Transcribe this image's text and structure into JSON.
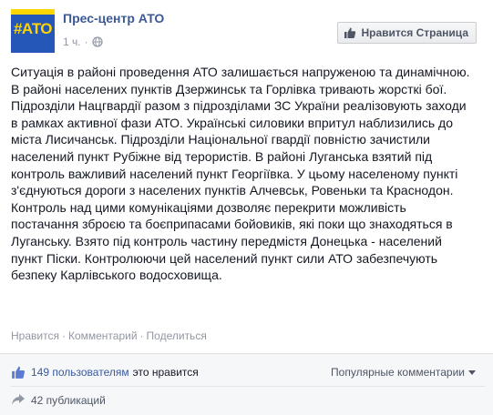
{
  "page": {
    "name": "Прес-центр АТО",
    "avatar_text": "#АТО",
    "brand_color": "#3b5998",
    "avatar_bg": "#2457b8",
    "avatar_accent": "#ffd500"
  },
  "post": {
    "time": "1 ч.",
    "meta_separator": "·",
    "audience_icon": "globe-icon",
    "body": "Ситуація в районі проведення АТО залишається напруженою та динамічною. В районі населених пунктів Дзержинськ та Горлівка тривають жорсткі бої. Підрозділи Нацгвардії разом з підрозділами ЗС України реалізовують заходи в рамках активної фази АТО. Українські силовики впритул наблизились до міста Лисичанськ. Підрозділи Національної гвардії повністю зачистили населений пункт Рубіжне від терористів. В районі Луганська взятий під контроль важливий населений пункт Георгіївка. У цьому населеному пункті з'єднуються дороги з населених пунктів Алчевськ, Ровеньки та Краснодон. Контроль над цими комунікаціями дозволяє перекрити можливість постачання зброєю та боєприпасами бойовиків, які поки що знаходяться в Луганську. Взято під контроль частину передмістя Донецька - населений пункт Піски. Контролюючи цей населений пункт сили АТО забезпечують безпеку Карлівського водосховища."
  },
  "like_page_button": {
    "label": "Нравится Страница",
    "icon": "thumbs-up-icon"
  },
  "actions": {
    "like": "Нравится",
    "comment": "Комментарий",
    "share": "Поделиться",
    "separator": "·"
  },
  "footer": {
    "likes_count": "149 пользователям",
    "likes_suffix": "это нравится",
    "comments_sort": "Популярные комментарии",
    "comments_sort_icon": "caret-down-icon",
    "shares": "42 публикаций",
    "like_icon": "thumbs-up-icon",
    "share_icon": "share-arrow-icon"
  }
}
